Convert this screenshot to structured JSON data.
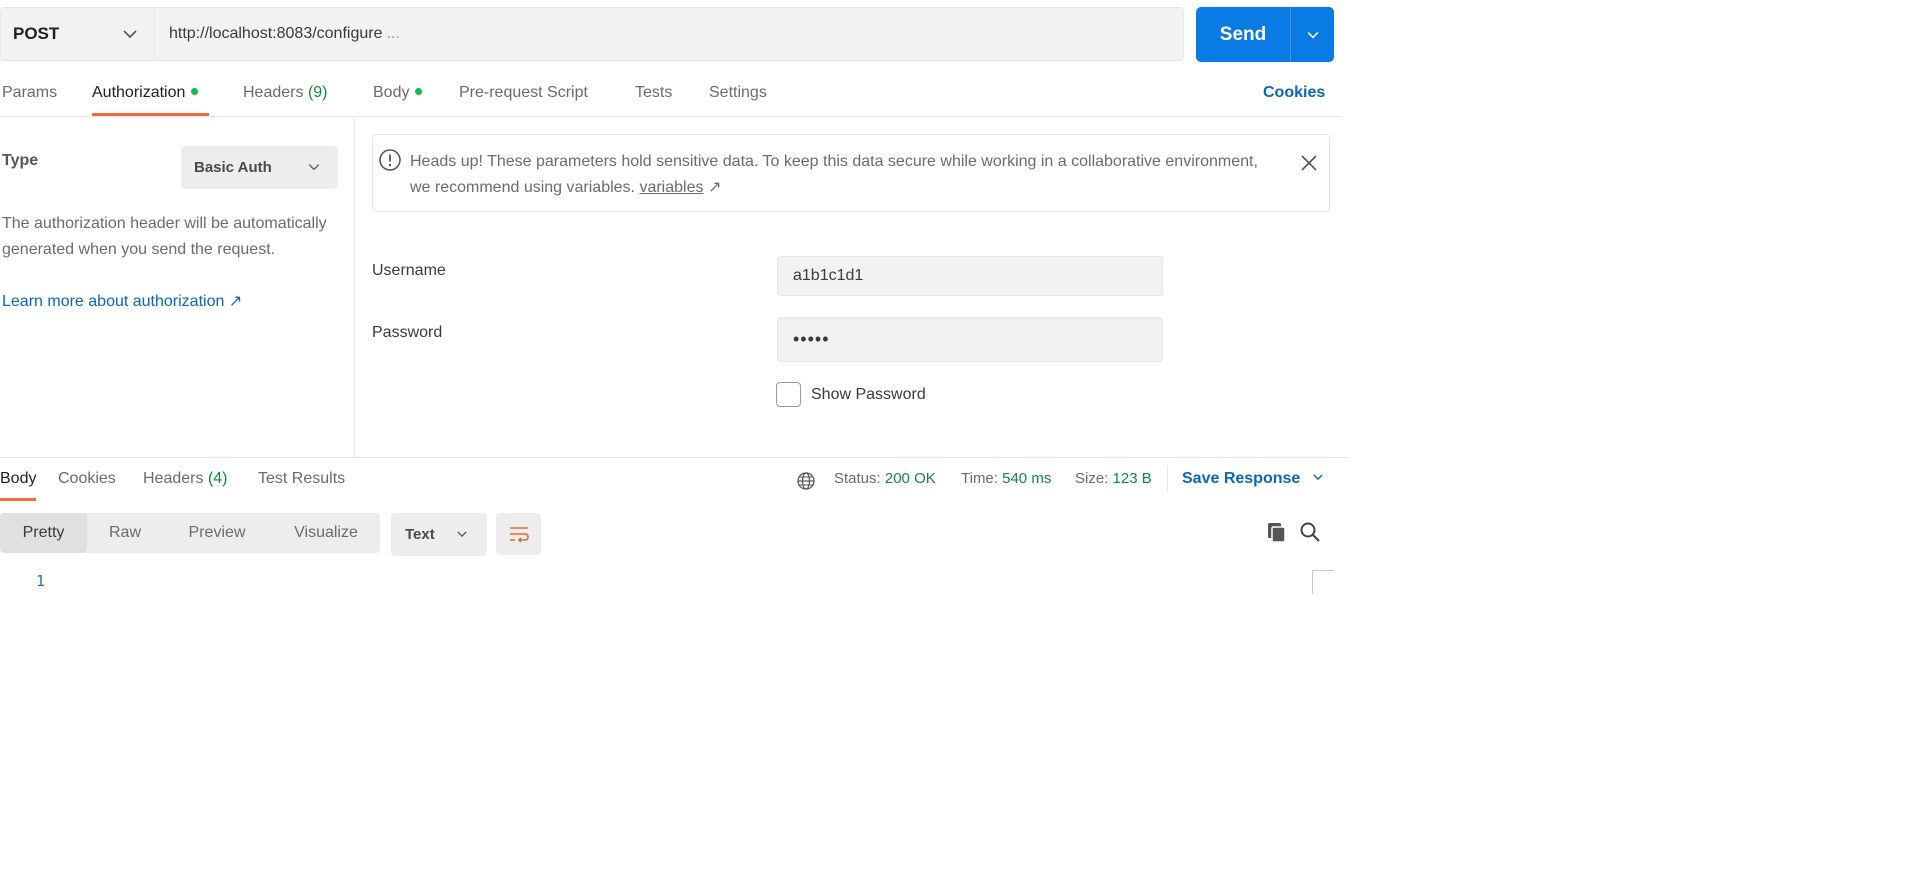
{
  "request": {
    "method": "POST",
    "url": "http://localhost:8083/configure",
    "url_ellipsis": "...",
    "send_label": "Send"
  },
  "request_tabs": {
    "params": "Params",
    "authorization": "Authorization",
    "headers": "Headers",
    "headers_count": "(9)",
    "body": "Body",
    "prerequest": "Pre-request Script",
    "tests": "Tests",
    "settings": "Settings",
    "cookies": "Cookies"
  },
  "auth": {
    "type_label": "Type",
    "type_value": "Basic Auth",
    "description": "The authorization header will be automatically generated when you send the request.",
    "learn_more": "Learn more about authorization ↗"
  },
  "notice": {
    "text": "Heads up! These parameters hold sensitive data. To keep this data secure while working in a collaborative environment, we recommend using variables.",
    "link": "variables",
    "link_arrow": "↗"
  },
  "fields": {
    "username_label": "Username",
    "username_value": "a1b1c1d1",
    "password_label": "Password",
    "password_value": "•••••",
    "show_password": "Show Password"
  },
  "response_tabs": {
    "body": "Body",
    "cookies": "Cookies",
    "headers": "Headers",
    "headers_count": "(4)",
    "test_results": "Test Results"
  },
  "status": {
    "status_label": "Status:",
    "status_value": "200 OK",
    "time_label": "Time:",
    "time_value": "540 ms",
    "size_label": "Size:",
    "size_value": "123 B",
    "save_response": "Save Response"
  },
  "viewer": {
    "pretty": "Pretty",
    "raw": "Raw",
    "preview": "Preview",
    "visualize": "Visualize",
    "format": "Text",
    "line_numbers": [
      "1"
    ]
  },
  "colors": {
    "accent_blue": "#0a7ae4",
    "link_blue": "#0a66c2",
    "tab_underline": "#f26b3a",
    "success_green": "#0f8a3c",
    "dot_green": "#0cbb52"
  },
  "icons": {
    "method_dropdown": "chevron-down-icon",
    "send_dropdown": "chevron-down-icon",
    "notice": "info-circle-icon",
    "close": "close-icon",
    "globe": "globe-icon",
    "wrap": "word-wrap-icon",
    "copy": "copy-icon",
    "search": "search-icon"
  }
}
